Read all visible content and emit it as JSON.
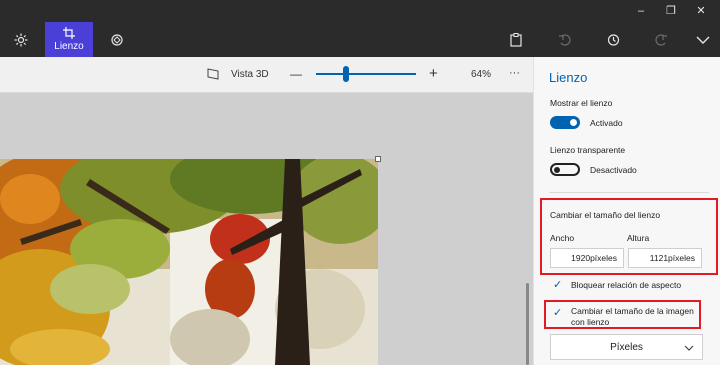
{
  "toolbar": {
    "lienzo_label": "Lienzo"
  },
  "subbar": {
    "view3d_label": "Vista 3D",
    "zoom_minus": "—",
    "zoom_plus": "+",
    "zoom_value": "64%",
    "more": "···",
    "zoom_level_fraction": 0.3
  },
  "panel": {
    "title": "Lienzo",
    "show_canvas_label": "Mostrar el lienzo",
    "show_canvas_state": "Activado",
    "transparent_label": "Lienzo transparente",
    "transparent_state": "Desactivado",
    "resize_title": "Cambiar el tamaño del lienzo",
    "width_label": "Ancho",
    "height_label": "Altura",
    "width_value": "1920píxeles",
    "height_value": "1121píxeles",
    "lock_aspect_label": "Bloquear relación de aspecto",
    "resize_image_label_1": "Cambiar el tamaño de la imagen",
    "resize_image_label_2": "con lienzo",
    "units_value": "Píxeles"
  },
  "colors": {
    "accent": "#0063b1",
    "active_tool": "#4a3fd6",
    "highlight": "#e01b24",
    "titlebar": "#2b2b2b"
  }
}
